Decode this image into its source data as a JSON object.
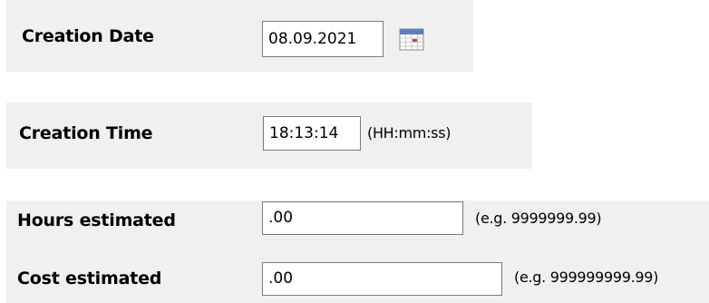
{
  "creation_date": {
    "label": "Creation Date",
    "value": "08.09.2021",
    "picker_icon": "calendar-icon"
  },
  "creation_time": {
    "label": "Creation Time",
    "value": "18:13:14",
    "format_hint": "(HH:mm:ss)"
  },
  "hours_estimated": {
    "label": "Hours estimated",
    "value": ".00",
    "example_hint": "(e.g. 9999999.99)"
  },
  "cost_estimated": {
    "label": "Cost estimated",
    "value": ".00",
    "example_hint": "(e.g. 999999999.99)"
  },
  "colors": {
    "panel_background": "#f0f0f0",
    "field_border": "#7a7a7a",
    "calendar_header": "#5b7fbf",
    "calendar_mark": "#d04040"
  }
}
